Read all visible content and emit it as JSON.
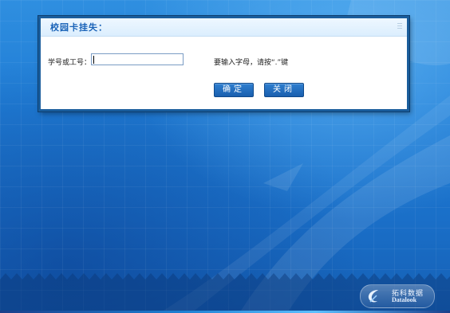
{
  "dialog": {
    "title": "校园卡挂失：",
    "id_label": "学号或工号：",
    "id_value": "",
    "hint": "要输入字母，请按“.”键",
    "ok_label": "确定",
    "close_label": "关闭"
  },
  "logo": {
    "name_cn": "拓科数据",
    "name_en": "Datalook"
  },
  "colors": {
    "background": "#1f7bd4",
    "dialog_border": "#1a5d9c",
    "title": "#1a63b8",
    "button": "#1a5fae"
  }
}
